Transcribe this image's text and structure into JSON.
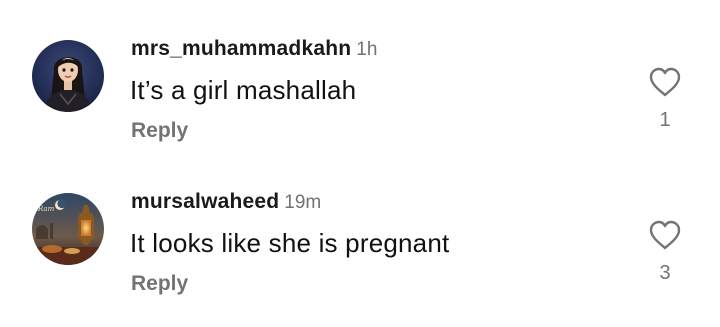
{
  "comments": [
    {
      "username": "mrs_muhammadkahn",
      "time": "1h",
      "text": "It’s a girl mashallah",
      "reply_label": "Reply",
      "like_count": "1",
      "avatar_icon": "avatar-female-character",
      "like_icon": "heart-outline-icon"
    },
    {
      "username": "mursalwaheed",
      "time": "19m",
      "text": "It looks like she is pregnant",
      "reply_label": "Reply",
      "like_count": "3",
      "avatar_icon": "avatar-ramadan-lantern",
      "like_icon": "heart-outline-icon"
    }
  ],
  "colors": {
    "primary_text": "#111111",
    "secondary_text": "#737373",
    "background": "#ffffff"
  }
}
